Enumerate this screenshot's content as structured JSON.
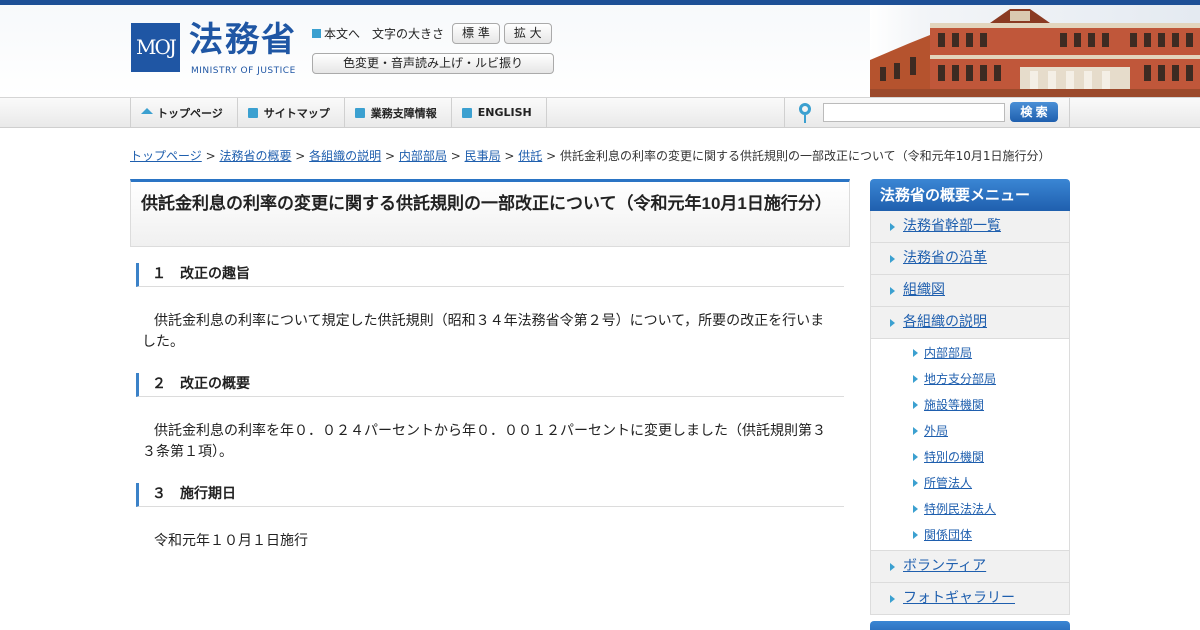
{
  "header": {
    "logo_mark": "MOJ",
    "logo_jp": "法務省",
    "logo_en": "MINISTRY OF JUSTICE",
    "skip_link": "本文へ",
    "font_size_label": "文字の大きさ",
    "font_standard": "標 準",
    "font_large": "拡 大",
    "accessibility_button": "色変更・音声読み上げ・ルビ振り"
  },
  "nav": {
    "items": [
      {
        "label": "トップページ"
      },
      {
        "label": "サイトマップ"
      },
      {
        "label": "業務支障情報"
      },
      {
        "label": "ENGLISH"
      }
    ],
    "search_placeholder": "",
    "search_button": "検 索"
  },
  "breadcrumb": {
    "links": [
      "トップページ",
      "法務省の概要",
      "各組織の説明",
      "内部部局",
      "民事局",
      "供託"
    ],
    "separator": " > ",
    "current": "供託金利息の利率の変更に関する供託規則の一部改正について（令和元年10月1日施行分）"
  },
  "page": {
    "title": "供託金利息の利率の変更に関する供託規則の一部改正について（令和元年10月1日施行分）",
    "sections": [
      {
        "heading": "１　改正の趣旨",
        "body": "供託金利息の利率について規定した供託規則（昭和３４年法務省令第２号）について，所要の改正を行いました。"
      },
      {
        "heading": "２　改正の概要",
        "body": "供託金利息の利率を年０．０２４パーセントから年０．００１２パーセントに変更しました（供託規則第３３条第１項）。"
      },
      {
        "heading": "３　施行期日",
        "body": "令和元年１０月１日施行"
      }
    ]
  },
  "sidebar": {
    "title": "法務省の概要メニュー",
    "items": [
      "法務省幹部一覧",
      "法務省の沿革",
      "組織図",
      "各組織の説明"
    ],
    "sub_items": [
      "内部部局",
      "地方支分部局",
      "施設等機関",
      "外局",
      "特別の機関",
      "所管法人",
      "特例民法法人",
      "関係団体"
    ],
    "items_after": [
      "ボランティア",
      "フォトギャラリー"
    ]
  },
  "colors": {
    "brand_blue": "#1f56a4",
    "accent_cyan": "#3ba0d0",
    "link": "#1f5fae"
  }
}
